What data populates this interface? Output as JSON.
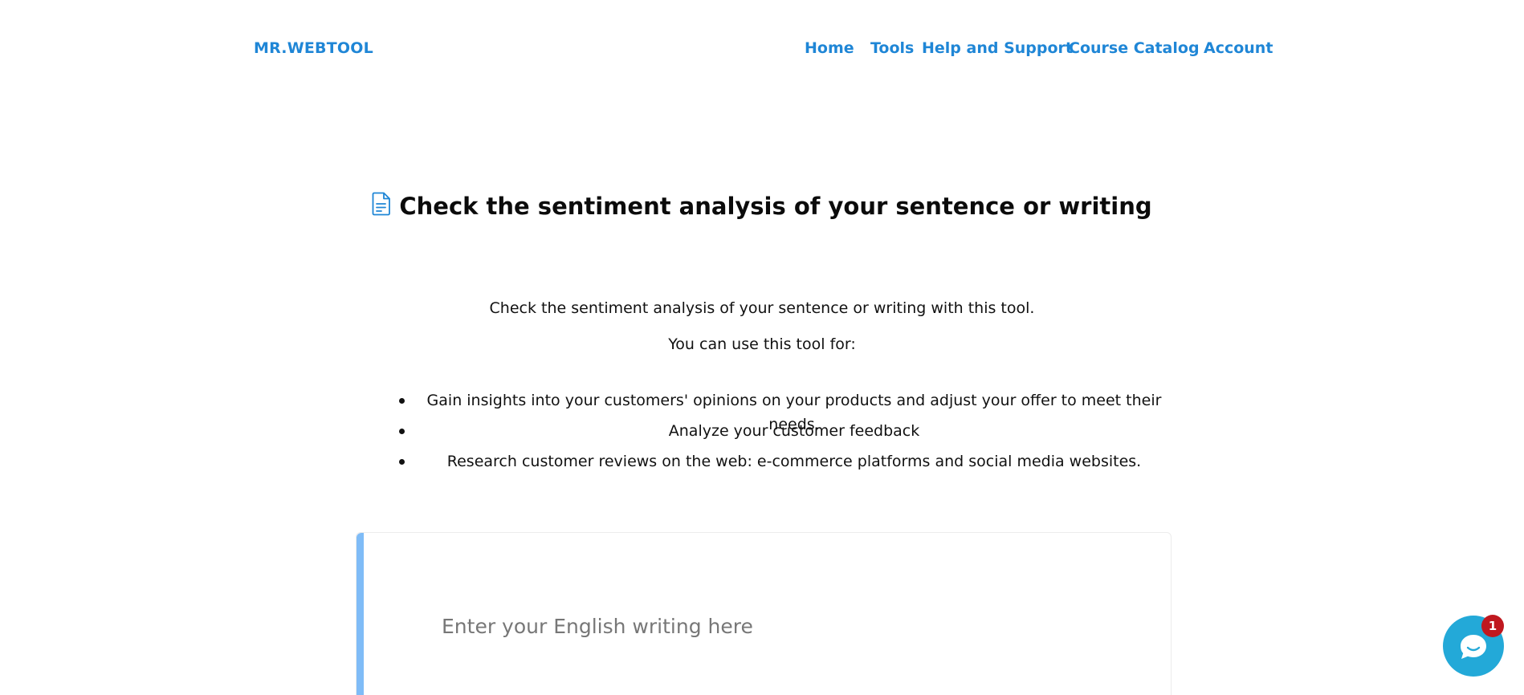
{
  "header": {
    "brand": "MR.WEBTOOL",
    "nav": {
      "home": "Home",
      "tools": "Tools",
      "help": "Help and Support",
      "course": "Course Catalog",
      "account": "Account"
    }
  },
  "main": {
    "title_icon": "document-icon",
    "title": "Check the sentiment analysis of your sentence or writing",
    "description": "Check the sentiment analysis of your sentence or writing with this tool.",
    "use_for": "You can use this tool for:",
    "bullets": [
      "Gain insights into your customers' opinions on your products and adjust your offer to meet their needs.",
      "Analyze your customer feedback",
      "Research customer reviews on the web: e-commerce platforms and social media websites."
    ]
  },
  "editor": {
    "placeholder": "Enter your English writing here"
  },
  "chat": {
    "icon": "chat-bubble-icon",
    "badge": "1"
  },
  "colors": {
    "accent": "#1f86d6",
    "card_accent": "#7fbcf7",
    "chat": "#23a9d8",
    "badge": "#c0181f"
  }
}
